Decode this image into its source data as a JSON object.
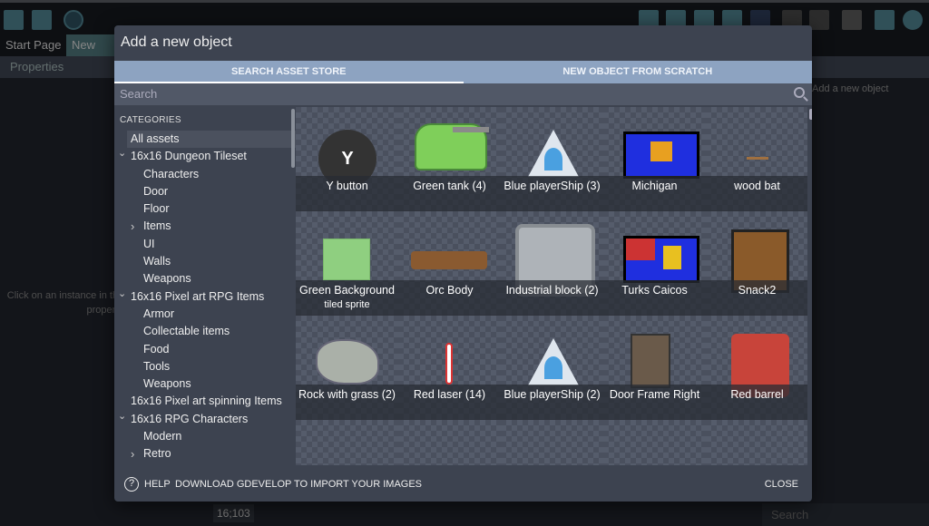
{
  "editor": {
    "tabs": [
      "Start Page",
      "New scene"
    ],
    "properties": "Properties",
    "hint": "Click on an instance in the scene to display its properties",
    "objects_hint": "Add a new object",
    "coords": "16;103",
    "search_placeholder": "Search"
  },
  "dialog": {
    "title": "Add a new object",
    "tabs": [
      "SEARCH ASSET STORE",
      "NEW OBJECT FROM SCRATCH"
    ],
    "search_placeholder": "Search",
    "categories_header": "CATEGORIES",
    "categories": [
      {
        "label": "All assets",
        "level": 0,
        "selected": true,
        "chevron": ""
      },
      {
        "label": "16x16 Dungeon Tileset",
        "level": 0,
        "chevron": "expanded"
      },
      {
        "label": "Characters",
        "level": 1,
        "chevron": ""
      },
      {
        "label": "Door",
        "level": 1,
        "chevron": ""
      },
      {
        "label": "Floor",
        "level": 1,
        "chevron": ""
      },
      {
        "label": "Items",
        "level": 1,
        "chevron": "collapsed"
      },
      {
        "label": "UI",
        "level": 1,
        "chevron": ""
      },
      {
        "label": "Walls",
        "level": 1,
        "chevron": ""
      },
      {
        "label": "Weapons",
        "level": 1,
        "chevron": ""
      },
      {
        "label": "16x16 Pixel art RPG Items",
        "level": 0,
        "chevron": "expanded"
      },
      {
        "label": "Armor",
        "level": 1,
        "chevron": ""
      },
      {
        "label": "Collectable items",
        "level": 1,
        "chevron": ""
      },
      {
        "label": "Food",
        "level": 1,
        "chevron": ""
      },
      {
        "label": "Tools",
        "level": 1,
        "chevron": ""
      },
      {
        "label": "Weapons",
        "level": 1,
        "chevron": ""
      },
      {
        "label": "16x16 Pixel art spinning Items",
        "level": 0,
        "chevron": ""
      },
      {
        "label": "16x16 RPG Characters",
        "level": 0,
        "chevron": "expanded"
      },
      {
        "label": "Modern",
        "level": 1,
        "chevron": ""
      },
      {
        "label": "Retro",
        "level": 1,
        "chevron": "collapsed"
      }
    ],
    "assets": [
      {
        "name": "Y button",
        "thumb": "y-button"
      },
      {
        "name": "Green tank (4)",
        "thumb": "tank"
      },
      {
        "name": "Blue playerShip (3)",
        "thumb": "ship"
      },
      {
        "name": "Michigan",
        "thumb": "flag-michigan"
      },
      {
        "name": "wood bat",
        "thumb": "bat"
      },
      {
        "name": "Green Background",
        "sub": "tiled sprite",
        "thumb": "green-bg"
      },
      {
        "name": "Orc Body",
        "thumb": "orc"
      },
      {
        "name": "Industrial block (2)",
        "thumb": "block"
      },
      {
        "name": "Turks Caicos",
        "thumb": "flag-turks"
      },
      {
        "name": "Snack2",
        "thumb": "snack"
      },
      {
        "name": "Rock with grass (2)",
        "thumb": "rock"
      },
      {
        "name": "Red laser (14)",
        "thumb": "laser"
      },
      {
        "name": "Blue playerShip (2)",
        "thumb": "ship"
      },
      {
        "name": "Door Frame Right",
        "thumb": "door"
      },
      {
        "name": "Red barrel",
        "thumb": "barrel"
      },
      {
        "name": "",
        "thumb": "red-pile"
      },
      {
        "name": "",
        "thumb": "blue-bar"
      },
      {
        "name": "",
        "thumb": "bread"
      },
      {
        "name": "",
        "thumb": "orange-pile"
      },
      {
        "name": "",
        "thumb": "tent"
      }
    ],
    "footer": {
      "help": "HELP",
      "download": "DOWNLOAD GDEVELOP TO IMPORT YOUR IMAGES",
      "close": "CLOSE"
    }
  }
}
